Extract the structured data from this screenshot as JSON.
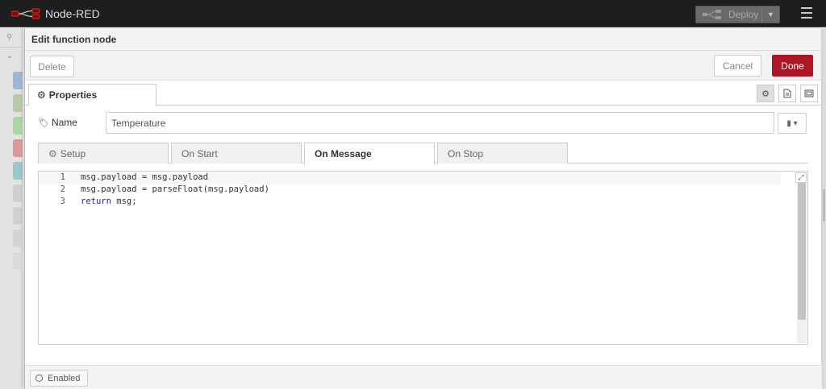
{
  "header": {
    "app_title": "Node-RED",
    "deploy_label": "Deploy"
  },
  "dialog": {
    "title": "Edit function node",
    "delete_label": "Delete",
    "cancel_label": "Cancel",
    "done_label": "Done",
    "done_color": "#ad1625",
    "properties_tab": "Properties",
    "name_label": "Name",
    "name_value": "Temperature",
    "code_tabs": [
      "Setup",
      "On Start",
      "On Message",
      "On Stop"
    ],
    "active_code_tab": "On Message",
    "code_lines": [
      {
        "num": "1",
        "text": "msg.payload = msg.payload"
      },
      {
        "num": "2",
        "text": "msg.payload = parseFloat(msg.payload)"
      },
      {
        "num": "3",
        "keyword": "return",
        "text": " msg;"
      }
    ],
    "enabled_label": "Enabled"
  },
  "icons": {
    "logo": "node-red-logo-icon",
    "deploy": "deploy-icon",
    "menu": "hamburger-menu-icon",
    "properties": "cog-icon",
    "name": "tag-icon",
    "library": "book-icon",
    "description": "file-icon",
    "appearance": "appearance-icon",
    "expand": "expand-icon"
  }
}
